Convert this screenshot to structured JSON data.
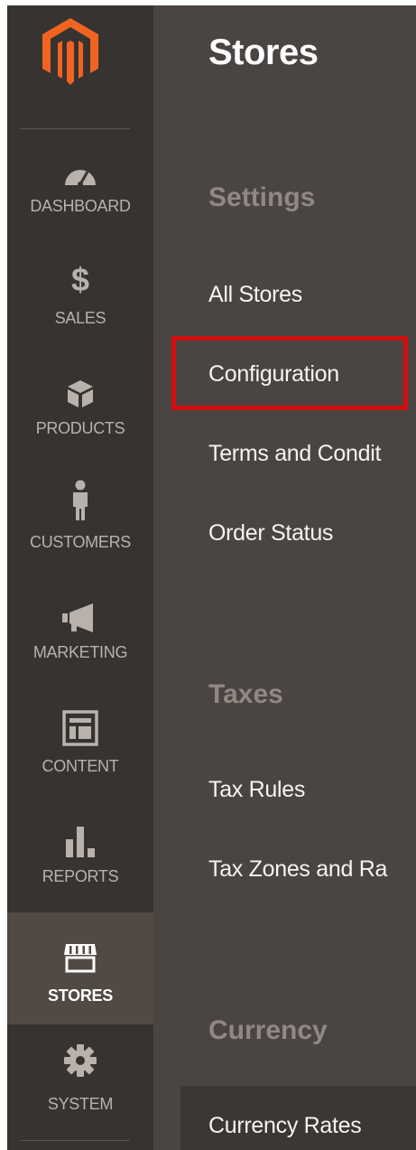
{
  "sidebar": {
    "items": [
      {
        "label": "DASHBOARD",
        "icon": "dashboard-icon"
      },
      {
        "label": "SALES",
        "icon": "dollar-icon"
      },
      {
        "label": "PRODUCTS",
        "icon": "box-icon"
      },
      {
        "label": "CUSTOMERS",
        "icon": "person-icon"
      },
      {
        "label": "MARKETING",
        "icon": "megaphone-icon"
      },
      {
        "label": "CONTENT",
        "icon": "layout-icon"
      },
      {
        "label": "REPORTS",
        "icon": "bar-chart-icon"
      },
      {
        "label": "STORES",
        "icon": "storefront-icon"
      },
      {
        "label": "SYSTEM",
        "icon": "gear-icon"
      }
    ],
    "active": "STORES"
  },
  "panel": {
    "title": "Stores",
    "groups": [
      {
        "title": "Settings",
        "items": [
          "All Stores",
          "Configuration",
          "Terms and Condit",
          "Order Status"
        ]
      },
      {
        "title": "Taxes",
        "items": [
          "Tax Rules",
          "Tax Zones and Ra"
        ]
      },
      {
        "title": "Currency",
        "items": [
          "Currency Rates"
        ]
      }
    ],
    "highlighted_item": "Configuration"
  },
  "colors": {
    "sidebar_bg": "#373330",
    "sidebar_active_bg": "#514943",
    "panel_bg": "#4a4542",
    "logo_orange": "#f26322",
    "highlight_border": "#d20f0f"
  }
}
